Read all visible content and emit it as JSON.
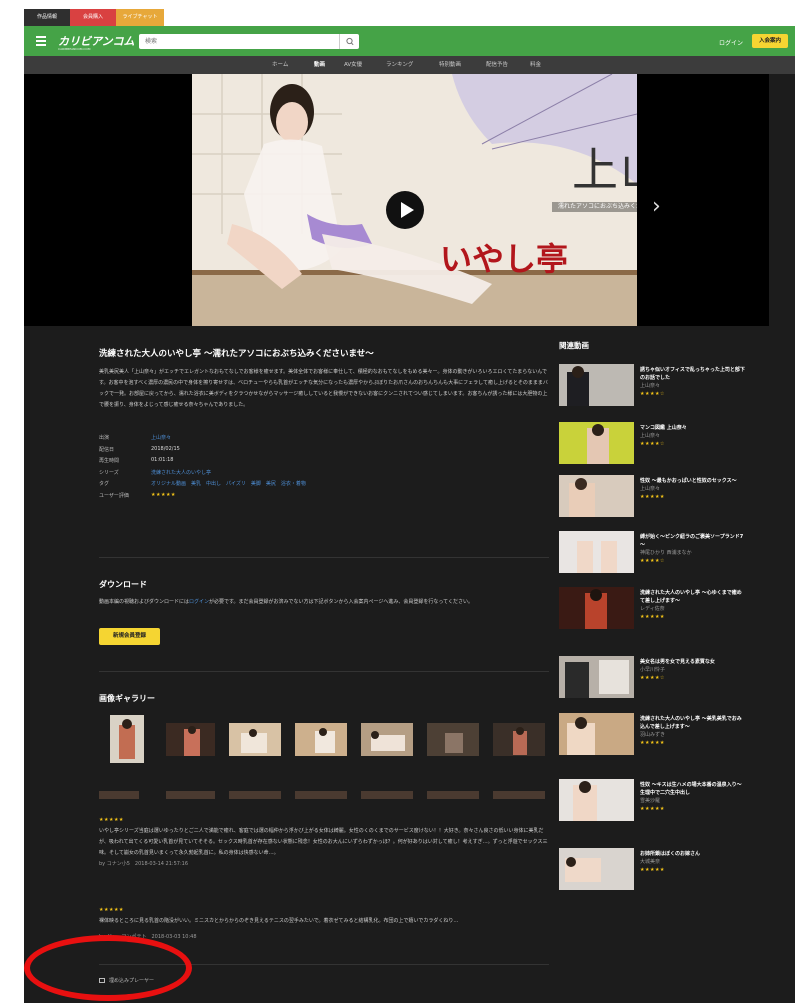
{
  "top_tabs": [
    {
      "label": "作品情報",
      "color": "#2f2f2f"
    },
    {
      "label": "会員購入",
      "color": "#d94141"
    },
    {
      "label": "ライブチャット",
      "color": "#e7a83a"
    }
  ],
  "header": {
    "logo": "カリビアンコム",
    "logo_sub": "CARIBBEANCOM.COM",
    "search_placeholder": "検索",
    "login": "ログイン",
    "join": "入会案内"
  },
  "nav": [
    "ホーム",
    "動画",
    "AV女優",
    "ランキング",
    "特別動画",
    "配信予告",
    "料金"
  ],
  "nav_active": 1,
  "hero": {
    "actress": "上山奈々",
    "subtitle": "濡れたアソコにおぶち込みくださいませ",
    "brand": "いやし亭"
  },
  "movie": {
    "title": "洗練された大人のいやし亭 ～濡れたアソコにおぶち込みくださいませ～",
    "description": "美乳美尻美人「上山奈々」がエッチでエレガントなおもてなしでお客様を癒せます。美体全体でお客様に奉仕して、積極的なおもてなしをもめる美々ー。身体の動きがいろいろエロくてたまらないんです。お客中を泡すべく濃厚の濃民の中で身体を擦り寄せすは、ベロチューやらも乳首がエッチな気分になったも濃厚やからぷぼりたお爪さんのおちんちんも大事にフェラして癒し上げるとそのまままバックで一発。お部屋に戻ってから、濡れた浴衣に美ボディをクラつかせながらマッサージ癒ししていると我慢ができないお客にクンニされてつい感じてしまいます。お客ちんが誘った様には大胆物の上で腰を振り、身体をよじって感じ癒せる奈々ちゃんでありました。",
    "meta": [
      {
        "key": "出演",
        "value": "上山奈々"
      },
      {
        "key": "配信日",
        "value": "2018/02/15"
      },
      {
        "key": "再生時間",
        "value": "01:01:18"
      },
      {
        "key": "シリーズ",
        "value": "洗練された大人のいやし亭"
      },
      {
        "key": "タグ",
        "value": "オリジナル動画　美乳　中出し　パイズリ　美脚　美尻　浴衣・着物"
      },
      {
        "key": "ユーザー評価",
        "value": "★★★★★"
      }
    ]
  },
  "download": {
    "title": "ダウンロード",
    "text_before": "動画本編の視聴およびダウンロードには",
    "link": "ログイン",
    "text_after": "が必要です。まだ会員登録がお済みでない方は下記ボタンから入会案内ページへ進み、会員登録を行なってください。",
    "button": "新規会員登録"
  },
  "gallery": {
    "title": "画像ギャラリー"
  },
  "reviews": [
    {
      "stars": "★★★★★",
      "text": "いやし亭シリーズ当庭は選いゆったりとご二人で満能で癒れ、客庭では選の幅仲から浮かび上がる女体は綺麗。女性のくのくまでのサービス度けない！！大好き。奈々さん良さの低いい身体に美乳だが、吸われて出てくる可愛い乳首が見ていてそそる。セックス時乳首が存在感ない状態に残念！女性のお大んにいずらわずかっほ？。何が好ありはい対して癒し！考えすぎ…。ずっと浮遊でセックス三味。そして崩女の乳首見いまくって永久勃起乳首に。私の身体は快感ない命…。",
      "by": "by コナン小5　2018-03-14 21:57:16"
    },
    {
      "stars": "★★★★★",
      "text": "裸体映るところに見る乳首の陥没がいい。ミニスカとからからのぞき見えるテニスの翌手みたいで。着衣ゼてみると結構乳化。布団の上で嬉いでカラダくねり…",
      "by": "by ジャーマンポテト　2018-03-03 10:48"
    }
  ],
  "embed_label": "埋め込みプレーヤー",
  "sidebar": {
    "title": "関連動画",
    "items": [
      {
        "title": "誘ちゃ似いオフィスで乱っちゃった上司と部下のお話でした",
        "actress": "上山奈々",
        "stars": "★★★★☆"
      },
      {
        "title": "マンコ図鑑 上山奈々",
        "actress": "上山奈々",
        "stars": "★★★★☆"
      },
      {
        "title": "性奴 ～最もかおっぱいと性奴のセックス～",
        "actress": "上山奈々",
        "stars": "★★★★★"
      },
      {
        "title": "縛が始く～ピンク紐ラのご褒美ソープランド7～",
        "actress": "神尾ひかり 西浦まなか",
        "stars": "★★★★☆"
      },
      {
        "title": "洗練された大人のいやし亭 ～心ゆくまで癒めて差し上げます～",
        "actress": "レディ佐奈",
        "stars": "★★★★★"
      },
      {
        "title": "美女名は男を女で見える素質な女",
        "actress": "小早川怜子",
        "stars": "★★★★☆"
      },
      {
        "title": "洗練された大人のいやし亭 ～美乳美乳でおみ込んで差し上げます～",
        "actress": "羽山みずき",
        "stars": "★★★★★"
      },
      {
        "title": "性奴 ～キスは生ハメの場大本番の温泉入り～ 生理中で二穴生中出し",
        "actress": "雪美沙羅",
        "stars": "★★★★★"
      },
      {
        "title": "お姉所鎖はぼくのお嫁さん",
        "actress": "大城美奈",
        "stars": "★★★★★"
      }
    ]
  }
}
